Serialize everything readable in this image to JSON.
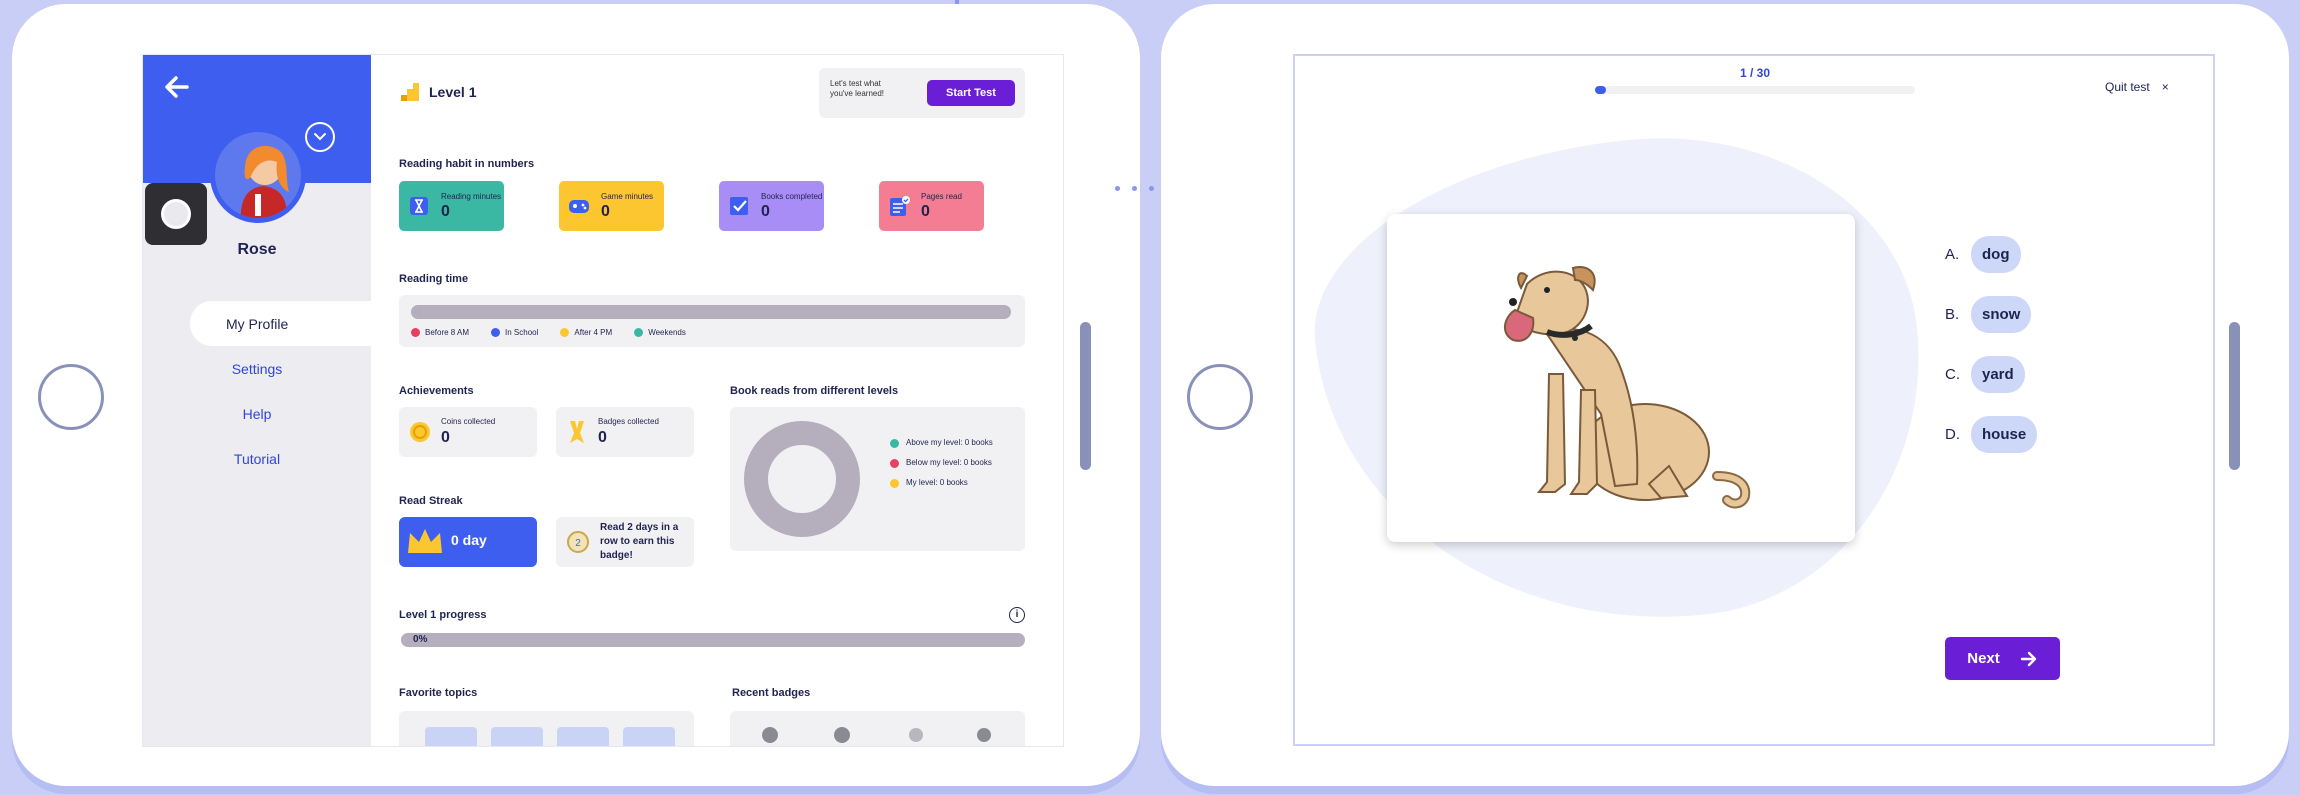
{
  "left_screen": {
    "profile": {
      "name": "Rose"
    },
    "nav": [
      "My Profile",
      "Settings",
      "Help",
      "Tutorial"
    ],
    "level": "Level 1",
    "start_test": {
      "hint": "Let's test what you've learned!",
      "button": "Start Test"
    },
    "reading_habit": {
      "title": "Reading habit in numbers",
      "stats": [
        {
          "label": "Reading minutes",
          "value": "0",
          "color": "#3bb8a4"
        },
        {
          "label": "Game minutes",
          "value": "0",
          "color": "#fbc62f"
        },
        {
          "label": "Books completed",
          "value": "0",
          "color": "#a98df6"
        },
        {
          "label": "Pages read",
          "value": "0",
          "color": "#f57d93"
        }
      ]
    },
    "reading_time": {
      "title": "Reading time",
      "legend": [
        {
          "label": "Before 8 AM",
          "color": "#e8405e"
        },
        {
          "label": "In School",
          "color": "#3e5ef0"
        },
        {
          "label": "After 4 PM",
          "color": "#fbc62f"
        },
        {
          "label": "Weekends",
          "color": "#3bb8a4"
        }
      ]
    },
    "achievements": {
      "title": "Achievements",
      "coins_label": "Coins collected",
      "coins": "0",
      "badges_label": "Badges collected",
      "badges": "0"
    },
    "book_reads": {
      "title": "Book reads from different levels",
      "legend": [
        {
          "label": "Above my level: 0 books",
          "color": "#3bb8a4"
        },
        {
          "label": "Below my level: 0 books",
          "color": "#e8405e"
        },
        {
          "label": "My level: 0 books",
          "color": "#fbc62f"
        }
      ]
    },
    "read_streak": {
      "title": "Read Streak",
      "value": "0 day",
      "hint": "Read 2 days in a row to earn this badge!"
    },
    "level_progress": {
      "title": "Level 1 progress",
      "percent": "0%"
    },
    "favorite_topics": {
      "title": "Favorite topics"
    },
    "recent_badges": {
      "title": "Recent badges"
    }
  },
  "right_screen": {
    "counter": "1 / 30",
    "progress_fraction": 0.033,
    "quit_label": "Quit test",
    "quit_icon": "×",
    "options": [
      {
        "letter": "A.",
        "text": "dog"
      },
      {
        "letter": "B.",
        "text": "snow"
      },
      {
        "letter": "C.",
        "text": "yard"
      },
      {
        "letter": "D.",
        "text": "house"
      }
    ],
    "next_label": "Next"
  }
}
